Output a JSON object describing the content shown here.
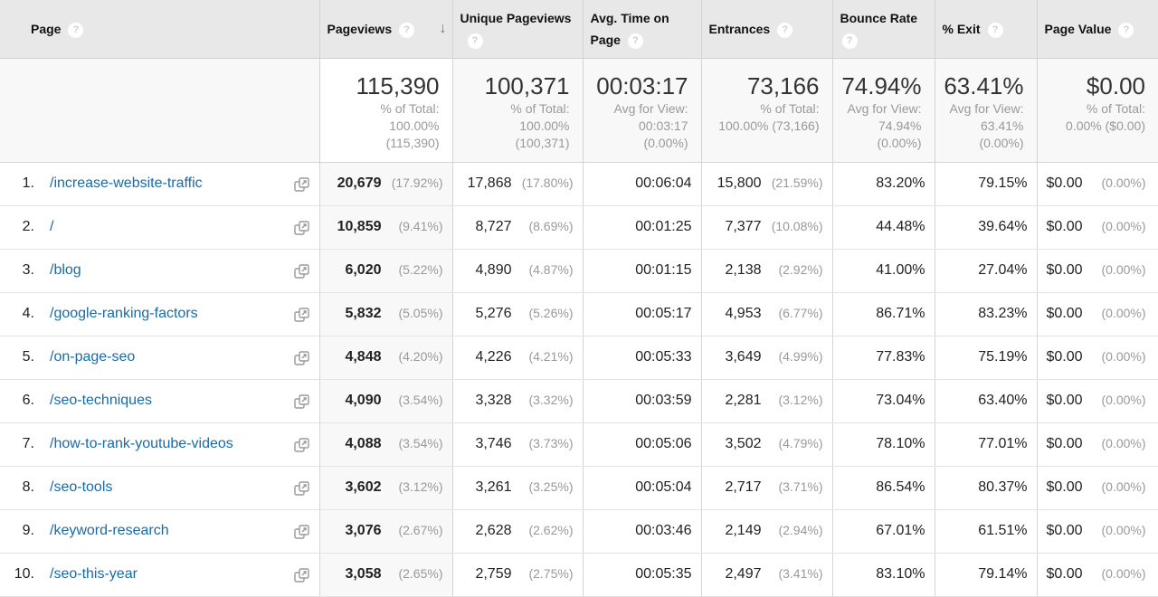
{
  "headers": {
    "page": "Page",
    "pageviews": "Pageviews",
    "unique_pageviews": "Unique Pageviews",
    "avg_time": "Avg. Time on Page",
    "entrances": "Entrances",
    "bounce_rate": "Bounce Rate",
    "exit": "% Exit",
    "page_value": "Page Value",
    "help_glyph": "?",
    "sort_arrow": "↓"
  },
  "totals": {
    "pageviews": {
      "value": "115,390",
      "l1": "% of Total:",
      "l2": "100.00%",
      "l3": "(115,390)"
    },
    "unique_pageviews": {
      "value": "100,371",
      "l1": "% of Total:",
      "l2": "100.00%",
      "l3": "(100,371)"
    },
    "avg_time": {
      "value": "00:03:17",
      "l1": "Avg for View:",
      "l2": "00:03:17",
      "l3": "(0.00%)"
    },
    "entrances": {
      "value": "73,166",
      "l1": "% of Total:",
      "l2": "100.00% (73,166)",
      "l3": ""
    },
    "bounce_rate": {
      "value": "74.94%",
      "l1": "Avg for View:",
      "l2": "74.94%",
      "l3": "(0.00%)"
    },
    "exit": {
      "value": "63.41%",
      "l1": "Avg for View:",
      "l2": "63.41%",
      "l3": "(0.00%)"
    },
    "page_value": {
      "value": "$0.00",
      "l1": "% of Total:",
      "l2": "0.00% ($0.00)",
      "l3": ""
    }
  },
  "rows": [
    {
      "idx": "1.",
      "page": "/increase-website-traffic",
      "pv": "20,679",
      "pv_pct": "(17.92%)",
      "upv": "17,868",
      "upv_pct": "(17.80%)",
      "atp": "00:06:04",
      "ent": "15,800",
      "ent_pct": "(21.59%)",
      "br": "83.20%",
      "exit": "79.15%",
      "val": "$0.00",
      "val_pct": "(0.00%)"
    },
    {
      "idx": "2.",
      "page": "/",
      "pv": "10,859",
      "pv_pct": "(9.41%)",
      "upv": "8,727",
      "upv_pct": "(8.69%)",
      "atp": "00:01:25",
      "ent": "7,377",
      "ent_pct": "(10.08%)",
      "br": "44.48%",
      "exit": "39.64%",
      "val": "$0.00",
      "val_pct": "(0.00%)"
    },
    {
      "idx": "3.",
      "page": "/blog",
      "pv": "6,020",
      "pv_pct": "(5.22%)",
      "upv": "4,890",
      "upv_pct": "(4.87%)",
      "atp": "00:01:15",
      "ent": "2,138",
      "ent_pct": "(2.92%)",
      "br": "41.00%",
      "exit": "27.04%",
      "val": "$0.00",
      "val_pct": "(0.00%)"
    },
    {
      "idx": "4.",
      "page": "/google-ranking-factors",
      "pv": "5,832",
      "pv_pct": "(5.05%)",
      "upv": "5,276",
      "upv_pct": "(5.26%)",
      "atp": "00:05:17",
      "ent": "4,953",
      "ent_pct": "(6.77%)",
      "br": "86.71%",
      "exit": "83.23%",
      "val": "$0.00",
      "val_pct": "(0.00%)"
    },
    {
      "idx": "5.",
      "page": "/on-page-seo",
      "pv": "4,848",
      "pv_pct": "(4.20%)",
      "upv": "4,226",
      "upv_pct": "(4.21%)",
      "atp": "00:05:33",
      "ent": "3,649",
      "ent_pct": "(4.99%)",
      "br": "77.83%",
      "exit": "75.19%",
      "val": "$0.00",
      "val_pct": "(0.00%)"
    },
    {
      "idx": "6.",
      "page": "/seo-techniques",
      "pv": "4,090",
      "pv_pct": "(3.54%)",
      "upv": "3,328",
      "upv_pct": "(3.32%)",
      "atp": "00:03:59",
      "ent": "2,281",
      "ent_pct": "(3.12%)",
      "br": "73.04%",
      "exit": "63.40%",
      "val": "$0.00",
      "val_pct": "(0.00%)"
    },
    {
      "idx": "7.",
      "page": "/how-to-rank-youtube-videos",
      "pv": "4,088",
      "pv_pct": "(3.54%)",
      "upv": "3,746",
      "upv_pct": "(3.73%)",
      "atp": "00:05:06",
      "ent": "3,502",
      "ent_pct": "(4.79%)",
      "br": "78.10%",
      "exit": "77.01%",
      "val": "$0.00",
      "val_pct": "(0.00%)"
    },
    {
      "idx": "8.",
      "page": "/seo-tools",
      "pv": "3,602",
      "pv_pct": "(3.12%)",
      "upv": "3,261",
      "upv_pct": "(3.25%)",
      "atp": "00:05:04",
      "ent": "2,717",
      "ent_pct": "(3.71%)",
      "br": "86.54%",
      "exit": "80.37%",
      "val": "$0.00",
      "val_pct": "(0.00%)"
    },
    {
      "idx": "9.",
      "page": "/keyword-research",
      "pv": "3,076",
      "pv_pct": "(2.67%)",
      "upv": "2,628",
      "upv_pct": "(2.62%)",
      "atp": "00:03:46",
      "ent": "2,149",
      "ent_pct": "(2.94%)",
      "br": "67.01%",
      "exit": "61.51%",
      "val": "$0.00",
      "val_pct": "(0.00%)"
    },
    {
      "idx": "10.",
      "page": "/seo-this-year",
      "pv": "3,058",
      "pv_pct": "(2.65%)",
      "upv": "2,759",
      "upv_pct": "(2.75%)",
      "atp": "00:05:35",
      "ent": "2,497",
      "ent_pct": "(3.41%)",
      "br": "83.10%",
      "exit": "79.14%",
      "val": "$0.00",
      "val_pct": "(0.00%)"
    }
  ]
}
